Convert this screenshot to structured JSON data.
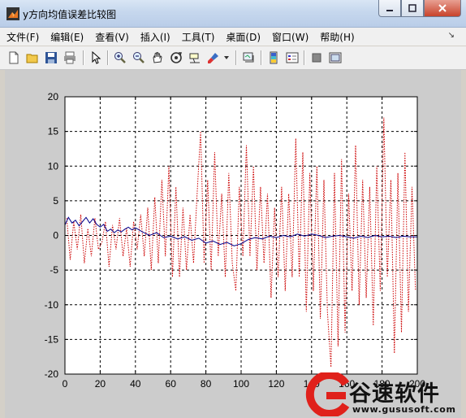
{
  "window": {
    "title": "y方向均值误差比较图"
  },
  "menu": {
    "items": [
      "文件(F)",
      "编辑(E)",
      "查看(V)",
      "插入(I)",
      "工具(T)",
      "桌面(D)",
      "窗口(W)",
      "帮助(H)"
    ]
  },
  "toolbar": {
    "buttons": [
      "new-icon",
      "open-icon",
      "save-icon",
      "print-icon",
      "pointer-icon",
      "zoom-in-icon",
      "zoom-out-icon",
      "pan-icon",
      "rotate-icon",
      "data-cursor-icon",
      "brush-icon",
      "link-icon",
      "colorbar-icon",
      "legend-icon",
      "hide-plot-tools-icon",
      "show-plot-tools-icon"
    ]
  },
  "watermark": {
    "brand": "谷速软件",
    "url": "www.gususoft.com"
  },
  "chart_data": {
    "type": "line",
    "xlim": [
      0,
      200
    ],
    "ylim": [
      -20,
      20
    ],
    "xticks": [
      0,
      20,
      40,
      60,
      80,
      100,
      120,
      140,
      160,
      180,
      200
    ],
    "yticks": [
      -20,
      -15,
      -10,
      -5,
      0,
      5,
      10,
      15,
      20
    ],
    "grid": true,
    "series": [
      {
        "color": "#cc0000",
        "style": "dotted",
        "x": [
          1,
          3,
          5,
          7,
          9,
          11,
          13,
          15,
          17,
          19,
          21,
          23,
          25,
          27,
          29,
          31,
          33,
          35,
          37,
          39,
          41,
          43,
          45,
          47,
          49,
          51,
          53,
          55,
          57,
          59,
          61,
          63,
          65,
          67,
          69,
          71,
          73,
          75,
          77,
          79,
          81,
          83,
          85,
          87,
          89,
          91,
          93,
          95,
          97,
          99,
          101,
          103,
          105,
          107,
          109,
          111,
          113,
          115,
          117,
          119,
          121,
          123,
          125,
          127,
          129,
          131,
          133,
          135,
          137,
          139,
          141,
          143,
          145,
          147,
          149,
          151,
          153,
          155,
          157,
          159,
          161,
          163,
          165,
          167,
          169,
          171,
          173,
          175,
          177,
          179,
          181,
          183,
          185,
          187,
          189,
          191,
          193,
          195,
          197,
          199
        ],
        "y": [
          2.5,
          -3.5,
          2,
          -2,
          3,
          -4,
          1,
          -3,
          2.5,
          -2,
          -1,
          2,
          -4.5,
          1.5,
          -2,
          2.5,
          -3,
          1,
          -4.5,
          2,
          -2,
          3,
          -3,
          4,
          -5,
          5.5,
          -4,
          8,
          -3,
          10,
          -6,
          7,
          -6,
          4,
          -5,
          3,
          -4,
          6,
          15,
          -4,
          8,
          -5,
          12,
          -3,
          6,
          -6,
          9,
          -4,
          -8,
          7,
          -3,
          13,
          -3,
          10,
          -5,
          7,
          -4,
          6,
          -9,
          4,
          -6,
          7,
          -8,
          6,
          -6,
          14,
          -6,
          12,
          -11,
          9,
          -8,
          10,
          -12,
          8,
          -11,
          -19,
          9,
          -16,
          11,
          -14,
          6,
          -8,
          13,
          -10,
          8,
          -9,
          7,
          -13,
          10,
          -8,
          17,
          -6,
          8,
          -17,
          9,
          -14,
          12,
          -11,
          7,
          -8
        ],
        "note": ""
      },
      {
        "color": "#00008b",
        "style": "solid",
        "x": [
          0,
          2,
          4,
          6,
          8,
          10,
          12,
          14,
          16,
          18,
          20,
          22,
          24,
          26,
          28,
          30,
          32,
          34,
          36,
          38,
          40,
          44,
          48,
          52,
          56,
          60,
          64,
          68,
          72,
          76,
          80,
          84,
          88,
          92,
          96,
          100,
          104,
          108,
          112,
          116,
          120,
          124,
          128,
          132,
          136,
          140,
          144,
          148,
          152,
          156,
          160,
          164,
          168,
          172,
          176,
          180,
          184,
          188,
          192,
          196,
          200
        ],
        "y": [
          1.5,
          2.6,
          1.8,
          2.2,
          1.4,
          2.0,
          2.6,
          1.8,
          2.4,
          1.6,
          1.2,
          1.6,
          0.6,
          0.9,
          0.4,
          0.8,
          0.5,
          0.9,
          1.2,
          0.8,
          1.1,
          0.5,
          0.0,
          0.4,
          -0.3,
          -0.1,
          -0.5,
          -0.2,
          -0.7,
          -0.4,
          -1.1,
          -0.8,
          -1.3,
          -1.0,
          -1.5,
          -1.2,
          -0.6,
          -0.3,
          -0.5,
          -0.1,
          -0.3,
          0.0,
          -0.2,
          0.2,
          -0.1,
          0.2,
          0.0,
          -0.3,
          -0.1,
          0.0,
          -0.2,
          -0.4,
          -0.1,
          -0.3,
          0.0,
          -0.2,
          -0.1,
          -0.3,
          -0.1,
          -0.2,
          -0.2
        ]
      }
    ]
  }
}
